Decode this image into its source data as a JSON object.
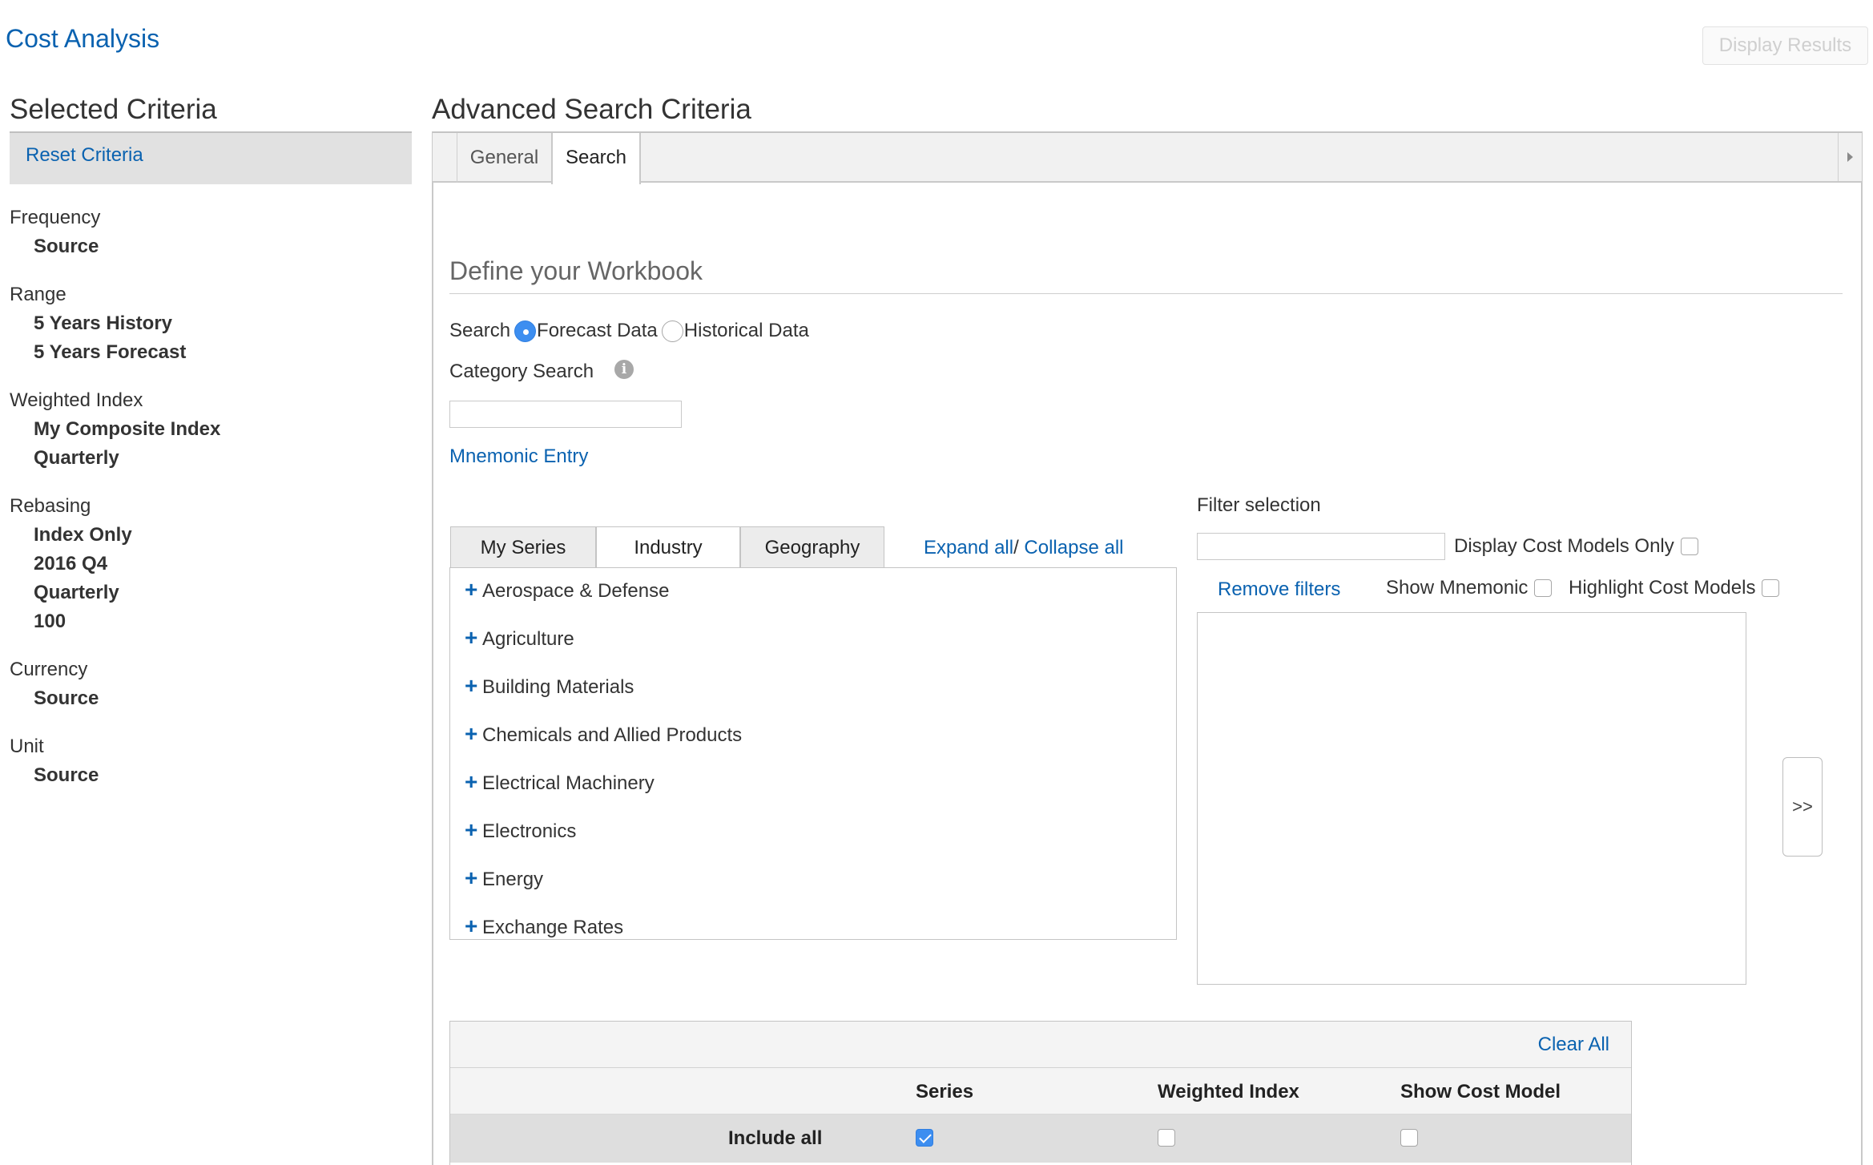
{
  "app": {
    "title": "Cost Analysis",
    "display_results": "Display Results"
  },
  "left": {
    "title": "Selected Criteria",
    "reset": "Reset Criteria",
    "groups": [
      {
        "label": "Frequency",
        "values": [
          "Source"
        ]
      },
      {
        "label": "Range",
        "values": [
          "5 Years History",
          "5 Years Forecast"
        ]
      },
      {
        "label": "Weighted Index",
        "values": [
          "My Composite Index",
          "Quarterly"
        ]
      },
      {
        "label": "Rebasing",
        "values": [
          "Index Only",
          "2016 Q4",
          "Quarterly",
          "100"
        ]
      },
      {
        "label": "Currency",
        "values": [
          "Source"
        ]
      },
      {
        "label": "Unit",
        "values": [
          "Source"
        ]
      }
    ]
  },
  "main": {
    "title": "Advanced Search Criteria",
    "tabs": [
      "General",
      "Search"
    ],
    "active_tab": "Search",
    "define_title": "Define your Workbook",
    "search_label": "Search",
    "radio_forecast": "Forecast Data",
    "radio_historical": "Historical Data",
    "selected_radio": "Forecast Data",
    "category_search": "Category Search",
    "category_value": "",
    "mnemonic_entry": "Mnemonic Entry",
    "series_tabs": [
      "My Series",
      "Industry",
      "Geography"
    ],
    "active_series_tab": "Industry",
    "expand_all": "Expand all",
    "collapse_all": "Collapse all",
    "tree": [
      "Aerospace & Defense",
      "Agriculture",
      "Building Materials",
      "Chemicals and Allied Products",
      "Electrical Machinery",
      "Electronics",
      "Energy",
      "Exchange Rates"
    ],
    "filter": {
      "label": "Filter selection",
      "value": "",
      "display_cost_models_only": "Display Cost Models Only",
      "remove_filters": "Remove filters",
      "show_mnemonic": "Show Mnemonic",
      "highlight_cost_models": "Highlight Cost Models",
      "move_button": ">>"
    },
    "table": {
      "clear_all": "Clear All",
      "headers": [
        "Series",
        "Weighted Index",
        "Show Cost Model"
      ],
      "row_label": "Include all",
      "row_checks": {
        "series": true,
        "weighted_index": false,
        "show_cost_model": false
      }
    }
  }
}
